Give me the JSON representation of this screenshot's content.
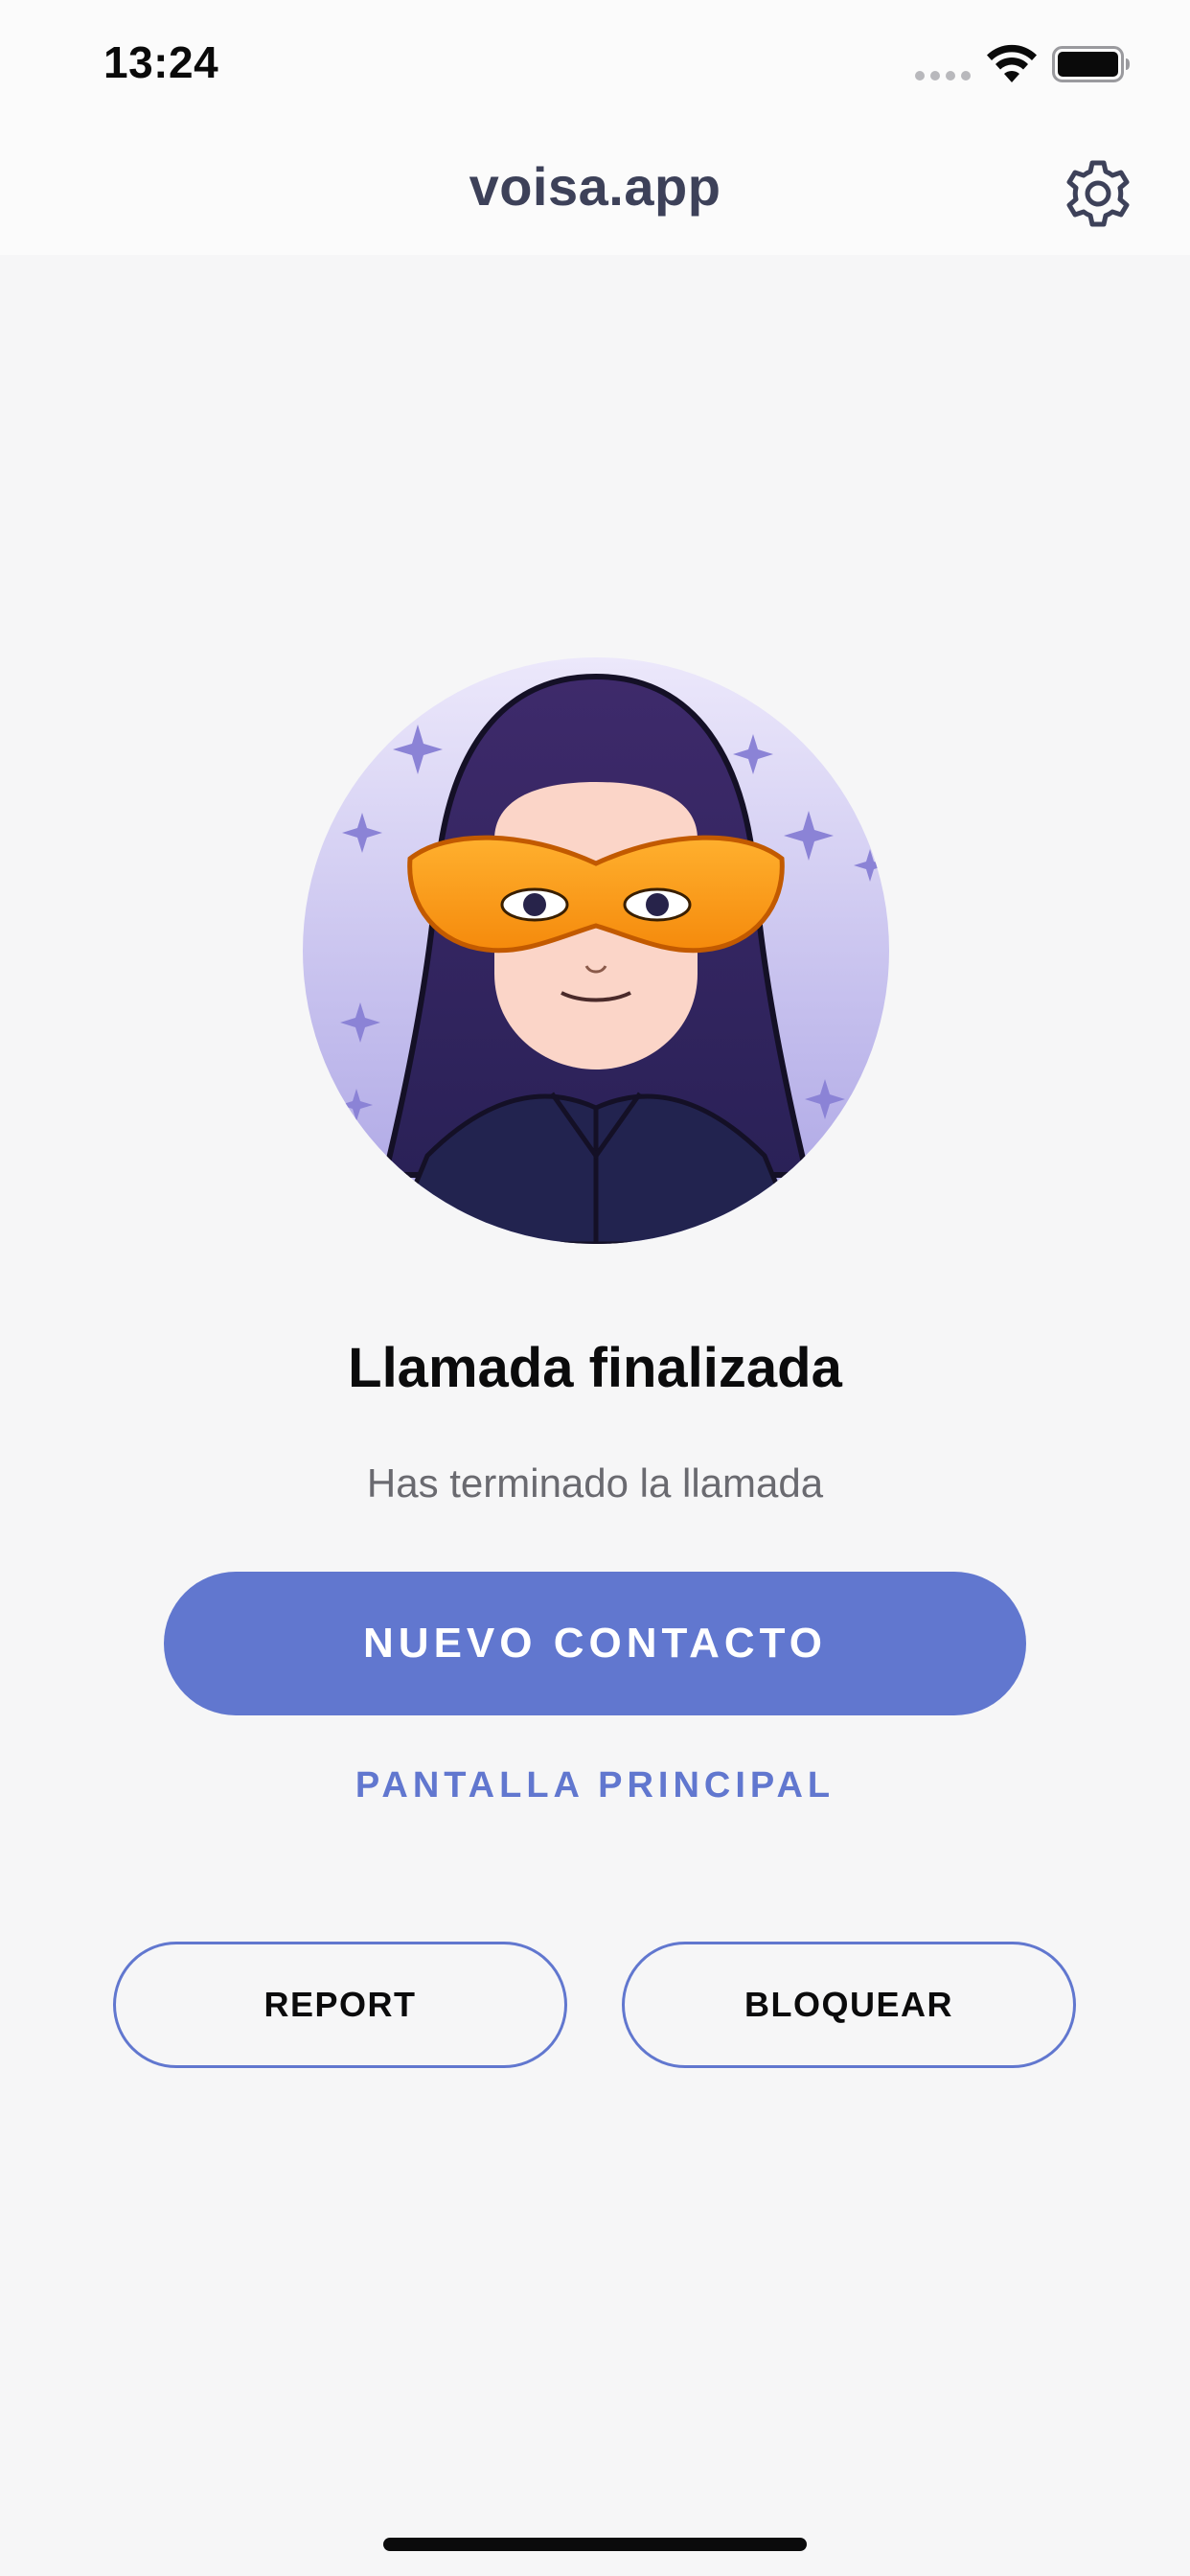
{
  "status_bar": {
    "time": "13:24",
    "icons": [
      "cellular-signal-icon",
      "wifi-icon",
      "battery-icon"
    ]
  },
  "header": {
    "title": "voisa.app",
    "settings_icon": "gear-icon"
  },
  "avatar": {
    "icon": "masked-hooded-avatar"
  },
  "main": {
    "title": "Llamada finalizada",
    "subtitle": "Has terminado la llamada",
    "primary_button": "NUEVO CONTACTO",
    "secondary_link": "PANTALLA PRINCIPAL",
    "report_button": "REPORT",
    "block_button": "BLOQUEAR"
  },
  "colors": {
    "accent": "#6177cf",
    "title_text": "#3d4159",
    "background": "#f6f6f7"
  }
}
